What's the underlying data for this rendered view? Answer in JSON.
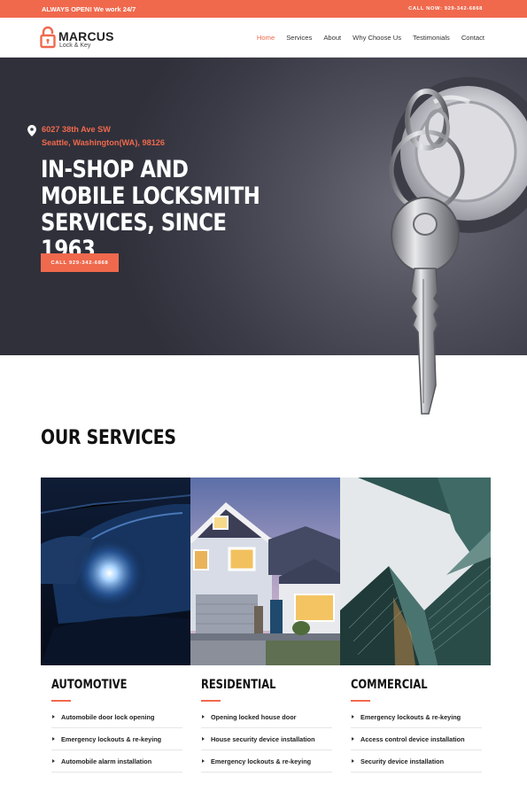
{
  "topbar": {
    "left_text": "ALWAYS OPEN! We work 24/7",
    "right_text": "CALL NOW: 929-342-6868"
  },
  "brand": {
    "name": "MARCUS",
    "sub": "Lock & Key"
  },
  "nav": {
    "items": [
      {
        "label": "Home",
        "active": true
      },
      {
        "label": "Services"
      },
      {
        "label": "About"
      },
      {
        "label": "Why Choose Us"
      },
      {
        "label": "Testimonials"
      },
      {
        "label": "Contact"
      }
    ]
  },
  "hero": {
    "address_line1": "6027 38th Ave SW",
    "address_line2": "Seattle, Washington(WA), 98126",
    "headline": "IN-SHOP AND MOBILE LOCKSMITH SERVICES, SINCE 1963",
    "cta_label": "CALL 929-342-6868",
    "icons": {
      "address": "map-pin-icon"
    }
  },
  "services": {
    "title": "OUR SERVICES",
    "columns": [
      {
        "title": "AUTOMOTIVE",
        "items": [
          "Automobile door lock opening",
          "Emergency lockouts & re-keying",
          "Automobile alarm installation"
        ]
      },
      {
        "title": "RESIDENTIAL",
        "items": [
          "Opening locked house door",
          "House security device installation",
          "Emergency lockouts & re-keying"
        ]
      },
      {
        "title": "COMMERCIAL",
        "items": [
          "Emergency lockouts & re-keying",
          "Access control device installation",
          "Security device installation"
        ]
      }
    ]
  },
  "colors": {
    "accent": "#f0694d",
    "hero_bg": "#3a3b46",
    "text_dark": "#1e1e1e"
  }
}
